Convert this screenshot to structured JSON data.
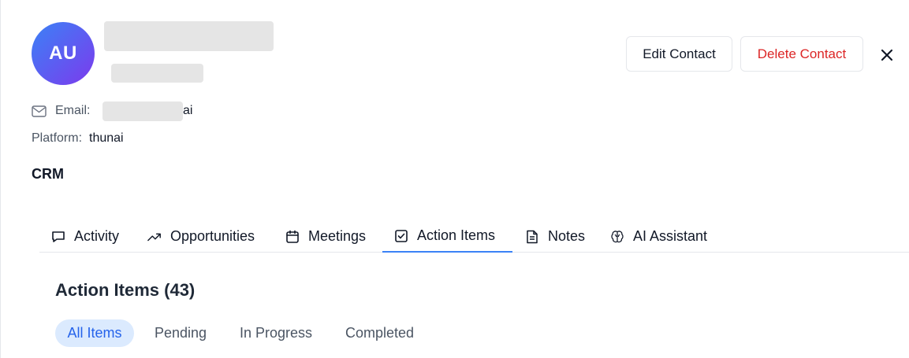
{
  "contact": {
    "initials": "AU",
    "email_label": "Email:",
    "email_tail": "ai",
    "platform_label": "Platform:",
    "platform_value": "thunai"
  },
  "actions": {
    "edit_label": "Edit Contact",
    "delete_label": "Delete Contact",
    "close_icon": "close-icon"
  },
  "section_title": "CRM",
  "tabs": [
    {
      "label": "Activity",
      "icon": "message-square-icon"
    },
    {
      "label": "Opportunities",
      "icon": "trending-up-icon"
    },
    {
      "label": "Meetings",
      "icon": "calendar-icon"
    },
    {
      "label": "Action Items",
      "icon": "check-square-icon",
      "active": true
    },
    {
      "label": "Notes",
      "icon": "file-text-icon"
    },
    {
      "label": "AI Assistant",
      "icon": "brain-icon"
    }
  ],
  "panel": {
    "title": "Action Items (43)",
    "filters": [
      {
        "label": "All Items",
        "active": true
      },
      {
        "label": "Pending"
      },
      {
        "label": "In Progress"
      },
      {
        "label": "Completed"
      }
    ]
  },
  "colors": {
    "accent": "#3b82f6",
    "danger": "#dc2626",
    "avatar_gradient_start": "#3b82f6",
    "avatar_gradient_end": "#7c3aed",
    "active_filter_bg": "#dbeafe"
  }
}
